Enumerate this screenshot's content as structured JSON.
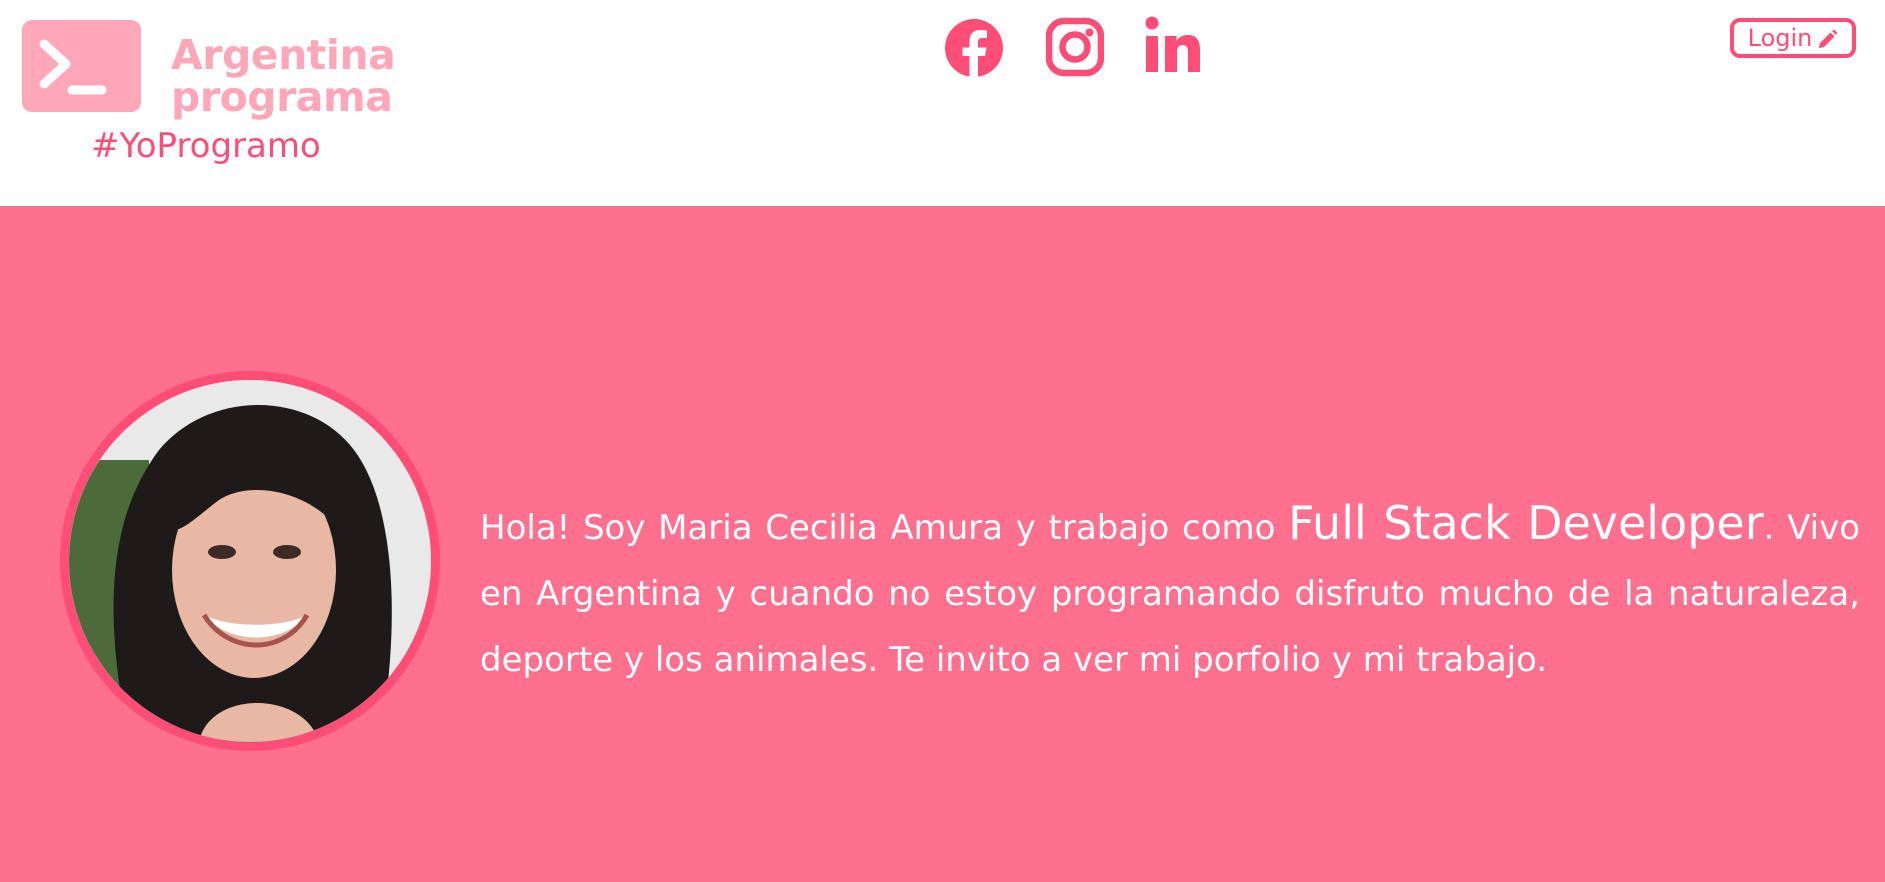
{
  "header": {
    "brand_line1": "Argentina",
    "brand_line2": "programa",
    "hashtag": "#YoProgramo",
    "login_label": "Login",
    "social": [
      {
        "name": "facebook-icon"
      },
      {
        "name": "instagram-icon"
      },
      {
        "name": "linkedin-icon"
      }
    ]
  },
  "hero": {
    "intro_before": "Hola! Soy Maria Cecilia Amura y trabajo como ",
    "role": "Full Stack Developer",
    "intro_after": ". Vivo en Argentina y cuando no estoy programando disfruto mucho de la naturaleza, deporte y los animales. Te invito a ver mi porfolio y mi trabajo."
  },
  "colors": {
    "brand_light": "#ffa7b8",
    "accent": "#ff4d77",
    "hero_bg": "#ff708f",
    "text_on_hero": "#ffffff"
  }
}
